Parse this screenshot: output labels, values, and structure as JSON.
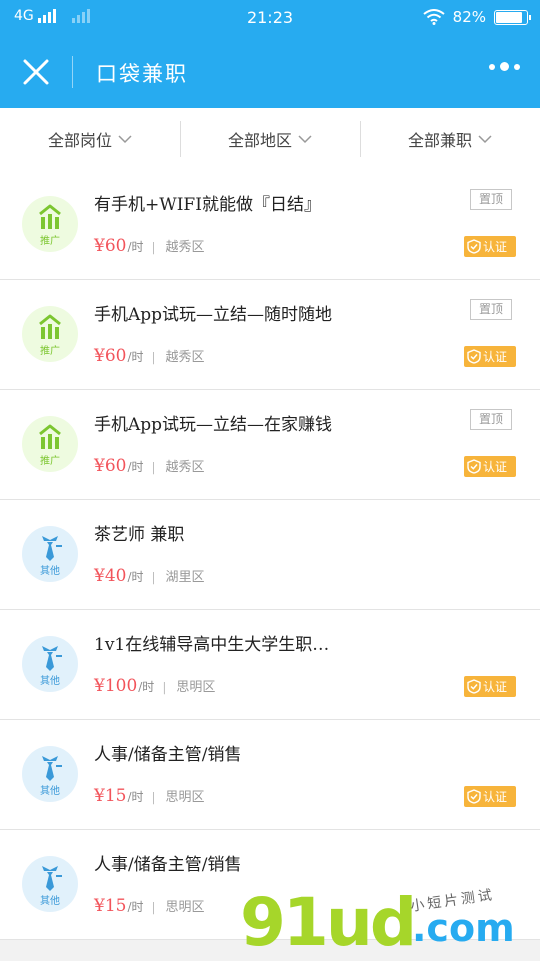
{
  "status_bar": {
    "network": "4G",
    "time": "21:23",
    "battery": "82%"
  },
  "header": {
    "title": "口袋兼职"
  },
  "filters": [
    {
      "label": "全部岗位"
    },
    {
      "label": "全部地区"
    },
    {
      "label": "全部兼职"
    }
  ],
  "jobs": [
    {
      "title": "有手机+WIFI就能做『日结』",
      "price": "¥60",
      "unit": "/时",
      "area": "越秀区",
      "icon": "promo-icon",
      "icon_label": "推广",
      "pinned": true,
      "pinned_label": "置顶",
      "verified": true,
      "verified_label": "认证"
    },
    {
      "title": "手机App试玩—立结—随时随地",
      "price": "¥60",
      "unit": "/时",
      "area": "越秀区",
      "icon": "promo-icon",
      "icon_label": "推广",
      "pinned": true,
      "pinned_label": "置顶",
      "verified": true,
      "verified_label": "认证"
    },
    {
      "title": "手机App试玩—立结—在家赚钱",
      "price": "¥60",
      "unit": "/时",
      "area": "越秀区",
      "icon": "promo-icon",
      "icon_label": "推广",
      "pinned": true,
      "pinned_label": "置顶",
      "verified": true,
      "verified_label": "认证"
    },
    {
      "title": "茶艺师 兼职",
      "price": "¥40",
      "unit": "/时",
      "area": "湖里区",
      "icon": "tie-icon",
      "icon_label": "其他",
      "pinned": false,
      "verified": false
    },
    {
      "title": "1v1在线辅导高中生大学生职…",
      "price": "¥100",
      "unit": "/时",
      "area": "思明区",
      "icon": "tie-icon",
      "icon_label": "其他",
      "pinned": false,
      "verified": true,
      "verified_label": "认证"
    },
    {
      "title": "人事/储备主管/销售",
      "price": "¥15",
      "unit": "/时",
      "area": "思明区",
      "icon": "tie-icon",
      "icon_label": "其他",
      "pinned": false,
      "verified": true,
      "verified_label": "认证"
    },
    {
      "title": "人事/储备主管/销售",
      "price": "¥15",
      "unit": "/时",
      "area": "思明区",
      "icon": "tie-icon",
      "icon_label": "其他",
      "pinned": false,
      "verified": false
    }
  ],
  "watermark": {
    "brand_number": "91",
    "brand_name": "ud",
    "brand_domain": ".com",
    "handwriting": "小短片测试"
  },
  "colors": {
    "primary": "#27abf0",
    "price": "#f2545b",
    "badge": "#f7b43b",
    "promo_green": "#7cc630",
    "other_blue": "#3a99d8"
  }
}
